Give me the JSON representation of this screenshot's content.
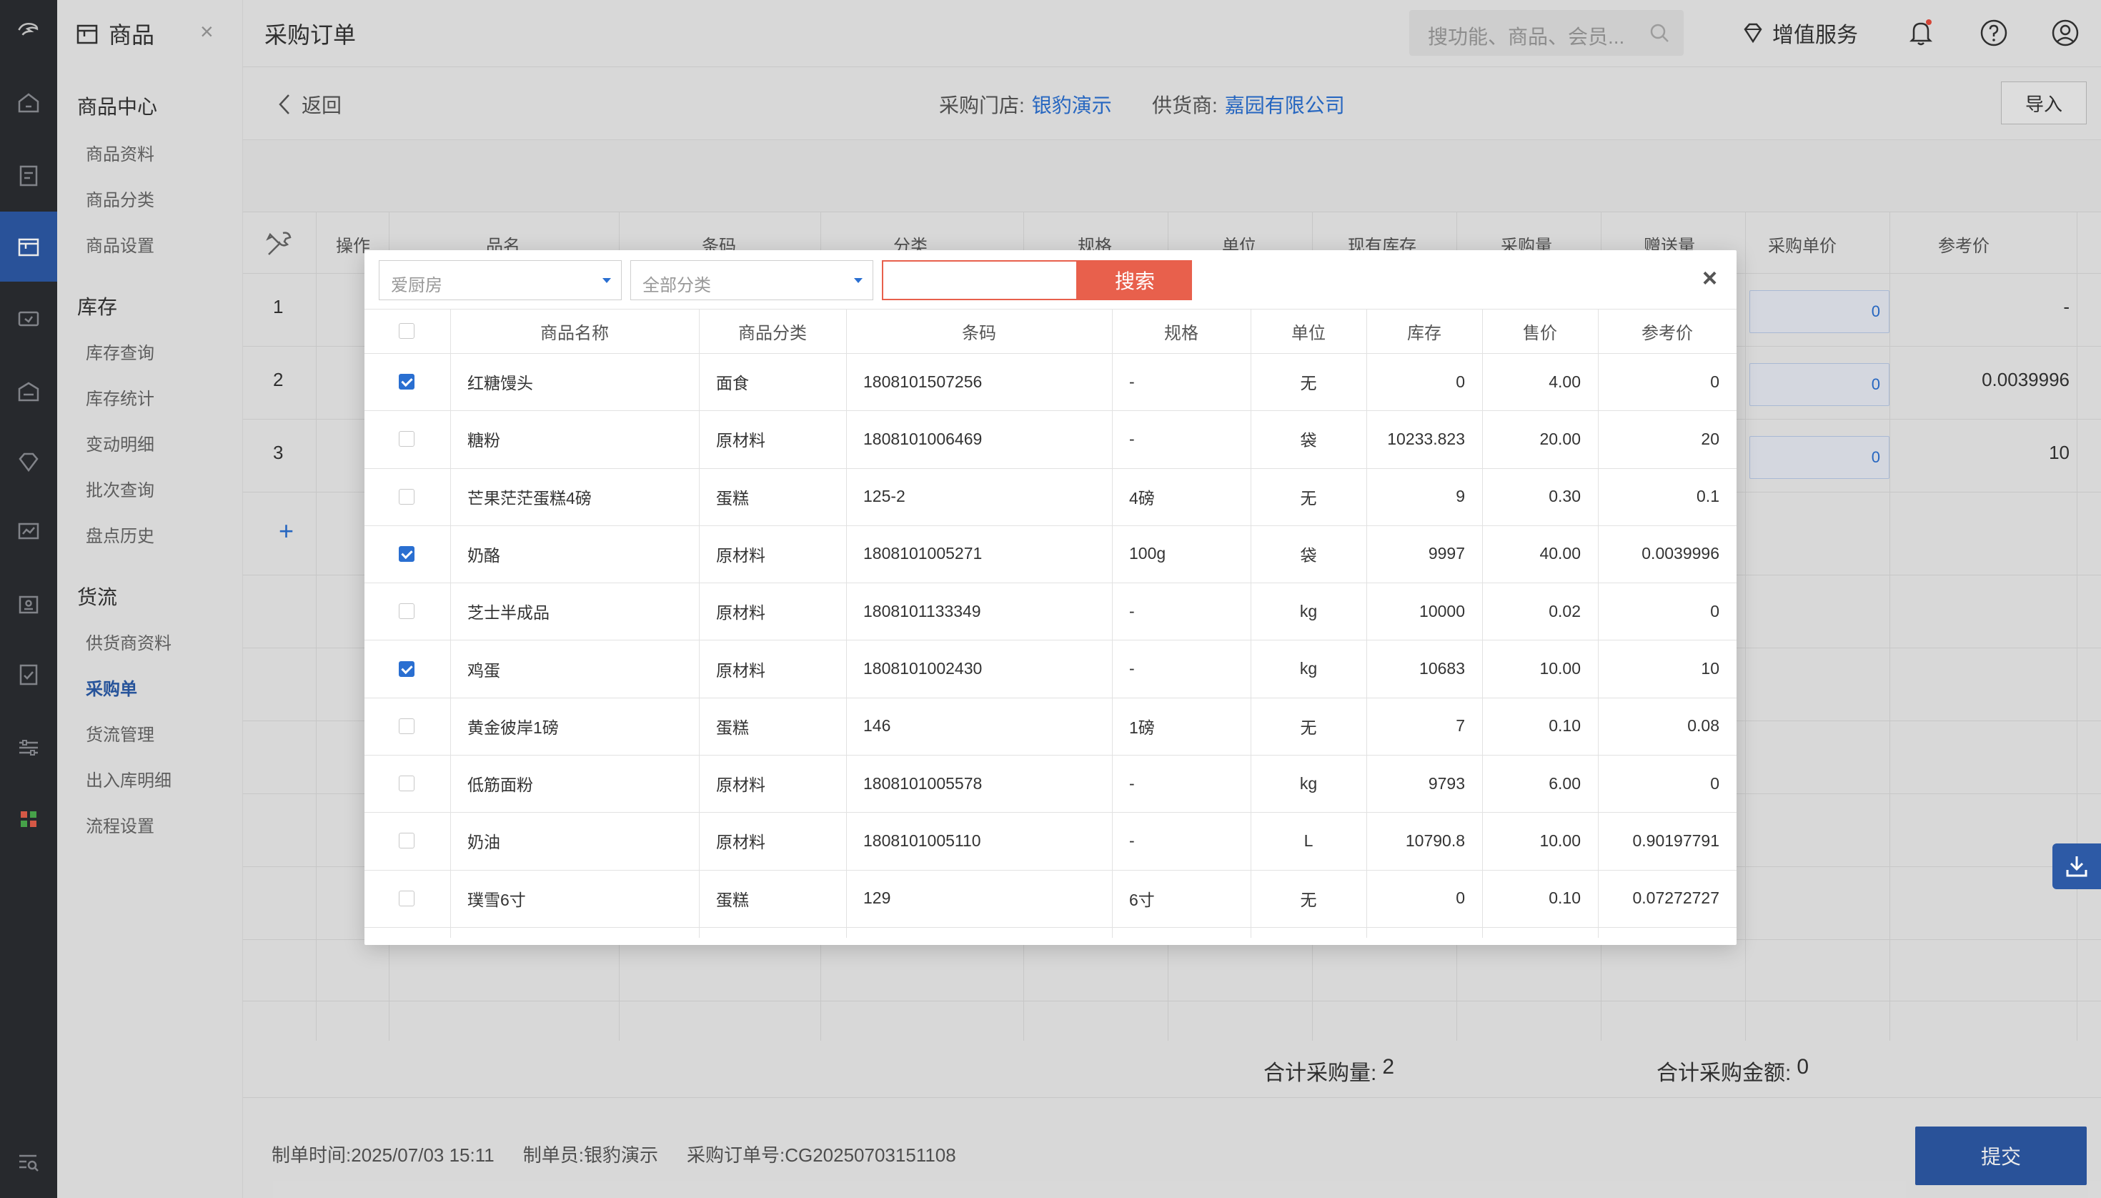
{
  "nav": {
    "title": "商品",
    "close": "×",
    "groups": [
      {
        "label": "商品中心"
      },
      {
        "label": "库存"
      },
      {
        "label": "货流"
      }
    ],
    "items": [
      "商品资料",
      "商品分类",
      "商品设置",
      "库存查询",
      "库存统计",
      "变动明细",
      "批次查询",
      "盘点历史",
      "供货商资料",
      "采购单",
      "货流管理",
      "出入库明细",
      "流程设置"
    ]
  },
  "header": {
    "title": "采购订单",
    "search_placeholder": "搜功能、商品、会员...",
    "vip_label": "增值服务"
  },
  "subbar": {
    "back": "返回",
    "store_label": "采购门店:",
    "store_value": "银豹演示",
    "supplier_label": "供货商:",
    "supplier_value": "嘉园有限公司",
    "import": "导入"
  },
  "bg_table": {
    "headers": [
      "操作",
      "品名",
      "条码",
      "分类",
      "规格",
      "单位",
      "现有库存",
      "采购量",
      "赠送量",
      "采购单价",
      "参考价"
    ],
    "rows": [
      {
        "idx": "1",
        "price": "0",
        "ref": "-"
      },
      {
        "idx": "2",
        "price": "0",
        "ref": "0.0039996"
      },
      {
        "idx": "3",
        "price": "0",
        "ref": "10"
      }
    ],
    "add": "+"
  },
  "totals": {
    "qty_label": "合计采购量:",
    "qty_value": "2",
    "amount_label": "合计采购金额:",
    "amount_value": "0"
  },
  "footer": {
    "time_label": "制单时间:",
    "time_value": "2025/07/03 15:11",
    "maker_label": "制单员:",
    "maker_value": "银豹演示",
    "order_label": "采购订单号:",
    "order_value": "CG20250703151108",
    "submit": "提交"
  },
  "modal": {
    "store_select": "爱厨房",
    "category_select": "全部分类",
    "search_button": "搜索",
    "close": "×",
    "headers": [
      "商品名称",
      "商品分类",
      "条码",
      "规格",
      "单位",
      "库存",
      "售价",
      "参考价"
    ],
    "rows": [
      {
        "checked": true,
        "name": "红糖馒头",
        "cat": "面食",
        "code": "1808101507256",
        "spec": "-",
        "unit": "无",
        "stock": "0",
        "price": "4.00",
        "ref": "0"
      },
      {
        "checked": false,
        "name": "糖粉",
        "cat": "原材料",
        "code": "1808101006469",
        "spec": "-",
        "unit": "袋",
        "stock": "10233.823",
        "price": "20.00",
        "ref": "20"
      },
      {
        "checked": false,
        "name": "芒果茫茫蛋糕4磅",
        "cat": "蛋糕",
        "code": "125-2",
        "spec": "4磅",
        "unit": "无",
        "stock": "9",
        "price": "0.30",
        "ref": "0.1"
      },
      {
        "checked": true,
        "name": "奶酪",
        "cat": "原材料",
        "code": "1808101005271",
        "spec": "100g",
        "unit": "袋",
        "stock": "9997",
        "price": "40.00",
        "ref": "0.0039996"
      },
      {
        "checked": false,
        "name": "芝士半成品",
        "cat": "原材料",
        "code": "1808101133349",
        "spec": "-",
        "unit": "kg",
        "stock": "10000",
        "price": "0.02",
        "ref": "0"
      },
      {
        "checked": true,
        "name": "鸡蛋",
        "cat": "原材料",
        "code": "1808101002430",
        "spec": "-",
        "unit": "kg",
        "stock": "10683",
        "price": "10.00",
        "ref": "10"
      },
      {
        "checked": false,
        "name": "黄金彼岸1磅",
        "cat": "蛋糕",
        "code": "146",
        "spec": "1磅",
        "unit": "无",
        "stock": "7",
        "price": "0.10",
        "ref": "0.08"
      },
      {
        "checked": false,
        "name": "低筋面粉",
        "cat": "原材料",
        "code": "1808101005578",
        "spec": "-",
        "unit": "kg",
        "stock": "9793",
        "price": "6.00",
        "ref": "0"
      },
      {
        "checked": false,
        "name": "奶油",
        "cat": "原材料",
        "code": "1808101005110",
        "spec": "-",
        "unit": "L",
        "stock": "10790.8",
        "price": "10.00",
        "ref": "0.90197791"
      },
      {
        "checked": false,
        "name": "璞雪6寸",
        "cat": "蛋糕",
        "code": "129",
        "spec": "6寸",
        "unit": "无",
        "stock": "0",
        "price": "0.10",
        "ref": "0.07272727"
      }
    ]
  },
  "colors": {
    "rail": "#2b2d31",
    "accent_blue": "#2d5aa6",
    "link_blue": "#2a6fd1",
    "search_red": "#e8604c",
    "notify_red": "#e84c3d"
  }
}
